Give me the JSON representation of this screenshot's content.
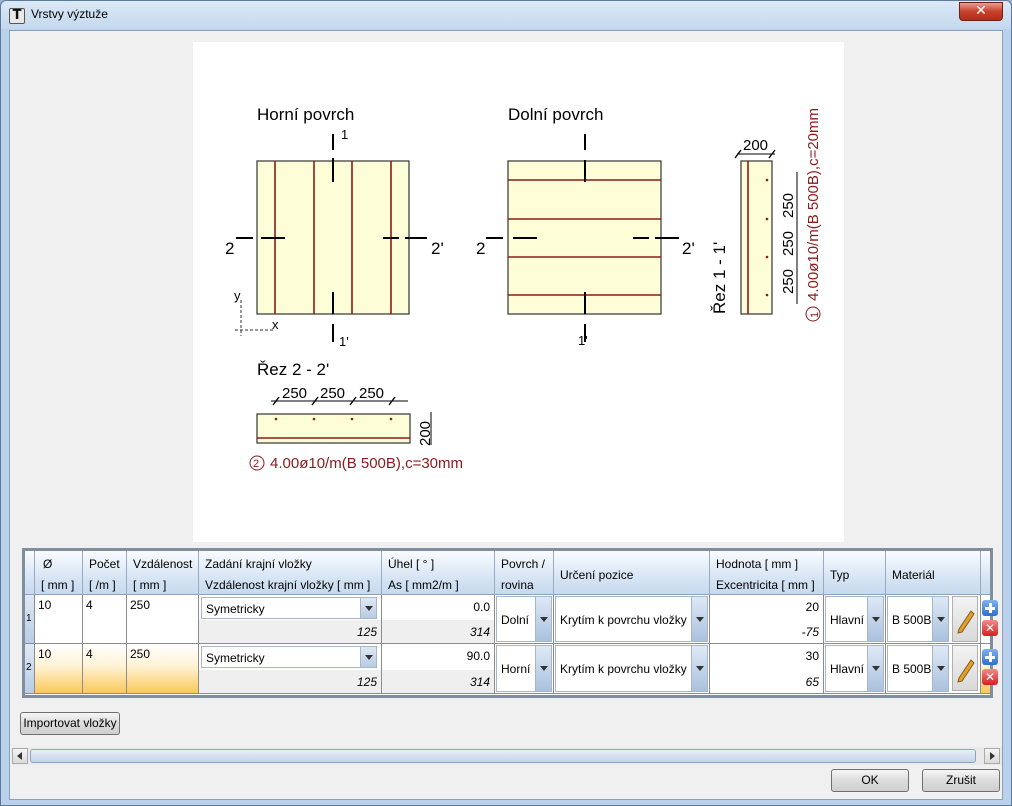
{
  "window": {
    "title": "Vrstvy výztuže",
    "close_label": "✕"
  },
  "drawing": {
    "top_title": "Horní povrch",
    "bottom_title": "Dolní povrch",
    "label_1": "1",
    "label_1p": "1'",
    "label_2": "2",
    "label_2p": "2'",
    "axis_x": "x",
    "axis_y": "y",
    "section_11": "Řez 1 - 1'",
    "section_22": "Řez 2 - 2'",
    "dim_200": "200",
    "dim_250": "250",
    "rebar_1_no": "1",
    "rebar_1": "4.00ø10/m(B 500B),c=20mm",
    "rebar_2_no": "2",
    "rebar_2": "4.00ø10/m(B 500B),c=30mm"
  },
  "grid": {
    "headers": {
      "dia": "Ø",
      "dia_unit": "[ mm ]",
      "count": "Počet",
      "count_unit": "[ /m ]",
      "spacing": "Vzdálenost",
      "spacing_unit": "[ mm ]",
      "edge": "Zadání krajní vložky",
      "edge_dist": "Vzdálenost krajní vložky  [ mm ]",
      "angle": "Úhel  [ ° ]",
      "as": "As  [ mm2/m ]",
      "surface": "Povrch /",
      "surface2": "rovina",
      "position": "Určení pozice",
      "value": "Hodnota  [ mm ]",
      "ecc": "Excentricita  [ mm ]",
      "type": "Typ",
      "material": "Materiál"
    },
    "rows": [
      {
        "no": "1",
        "dia": "10",
        "count": "4",
        "spacing": "250",
        "edge": "Symetricky",
        "edge_dist": "125",
        "angle": "0.0",
        "as": "314",
        "surface": "Dolní",
        "position": "Krytím k povrchu vložky",
        "value": "20",
        "ecc": "-75",
        "type": "Hlavní",
        "material": "B 500B"
      },
      {
        "no": "2",
        "dia": "10",
        "count": "4",
        "spacing": "250",
        "edge": "Symetricky",
        "edge_dist": "125",
        "angle": "90.0",
        "as": "314",
        "surface": "Horní",
        "position": "Krytím k povrchu vložky",
        "value": "30",
        "ecc": "65",
        "type": "Hlavní",
        "material": "B 500B"
      }
    ]
  },
  "buttons": {
    "import": "Importovat vložky",
    "ok": "OK",
    "cancel": "Zrušit"
  },
  "colors": {
    "rebar": "#8b1a1a",
    "slab": "#fdfdd8"
  }
}
